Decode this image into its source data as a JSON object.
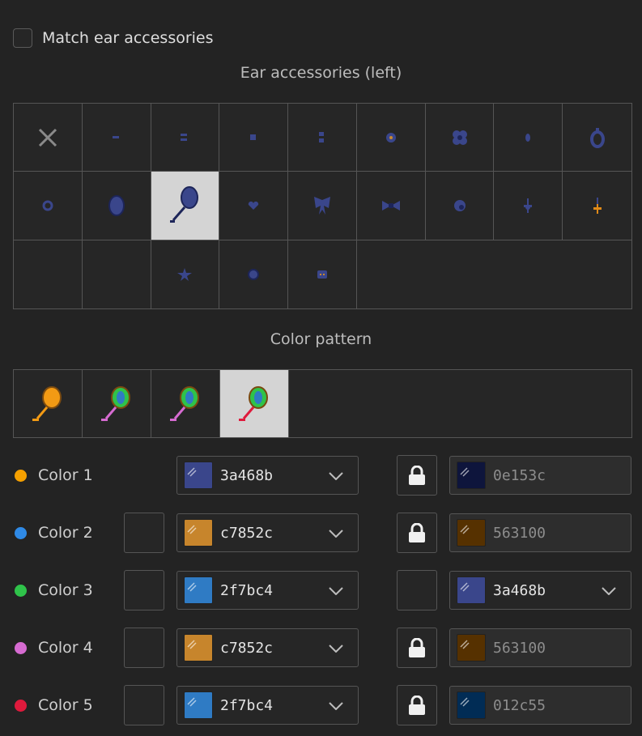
{
  "match": {
    "label": "Match ear accessories",
    "checked": false
  },
  "ear_section": {
    "title": "Ear accessories (left)",
    "items": [
      {
        "icon": "none-x-icon"
      },
      {
        "icon": "dash-stud-icon"
      },
      {
        "icon": "double-dash-stud-icon"
      },
      {
        "icon": "square-stud-icon"
      },
      {
        "icon": "double-dot-stud-icon"
      },
      {
        "icon": "ring-stud-icon"
      },
      {
        "icon": "flower-stud-icon"
      },
      {
        "icon": "small-drop-icon"
      },
      {
        "icon": "hoop-icon"
      },
      {
        "icon": "crescent-hoop-icon"
      },
      {
        "icon": "oval-gem-icon"
      },
      {
        "icon": "long-drop-earring-icon",
        "selected": true
      },
      {
        "icon": "heart-stud-icon"
      },
      {
        "icon": "butterfly-icon"
      },
      {
        "icon": "bow-icon"
      },
      {
        "icon": "swirl-icon"
      },
      {
        "icon": "cross-drop-icon"
      },
      {
        "icon": "orange-cross-drop-icon"
      },
      {
        "icon": "crescent-left-icon"
      },
      {
        "icon": "crescent-right-icon"
      },
      {
        "icon": "star-stud-icon"
      },
      {
        "icon": "round-stud-icon"
      },
      {
        "icon": "face-stud-icon"
      }
    ]
  },
  "pattern_section": {
    "title": "Color pattern",
    "items": [
      {
        "icon": "pattern-solid-orange-icon"
      },
      {
        "icon": "pattern-green-blue-icon"
      },
      {
        "icon": "pattern-green-blue-alt-icon"
      },
      {
        "icon": "pattern-full-icon",
        "selected": true
      }
    ]
  },
  "colors": [
    {
      "label": "Color 1",
      "dot": "#f5a000",
      "has_small_box": false,
      "main_hex": "3a468b",
      "main_color": "#3a468b",
      "locked": true,
      "secondary_hex": "0e153c",
      "secondary_color": "#0e153c"
    },
    {
      "label": "Color 2",
      "dot": "#2f8ae6",
      "has_small_box": true,
      "main_hex": "c7852c",
      "main_color": "#c7852c",
      "locked": true,
      "secondary_hex": "563100",
      "secondary_color": "#563100"
    },
    {
      "label": "Color 3",
      "dot": "#2fc34a",
      "has_small_box": true,
      "main_hex": "2f7bc4",
      "main_color": "#2f7bc4",
      "locked": false,
      "secondary_hex": "3a468b",
      "secondary_color": "#3a468b"
    },
    {
      "label": "Color 4",
      "dot": "#d66bd1",
      "has_small_box": true,
      "main_hex": "c7852c",
      "main_color": "#c7852c",
      "locked": true,
      "secondary_hex": "563100",
      "secondary_color": "#563100"
    },
    {
      "label": "Color 5",
      "dot": "#df1a3c",
      "has_small_box": true,
      "main_hex": "2f7bc4",
      "main_color": "#2f7bc4",
      "locked": true,
      "secondary_hex": "012c55",
      "secondary_color": "#012c55"
    }
  ]
}
